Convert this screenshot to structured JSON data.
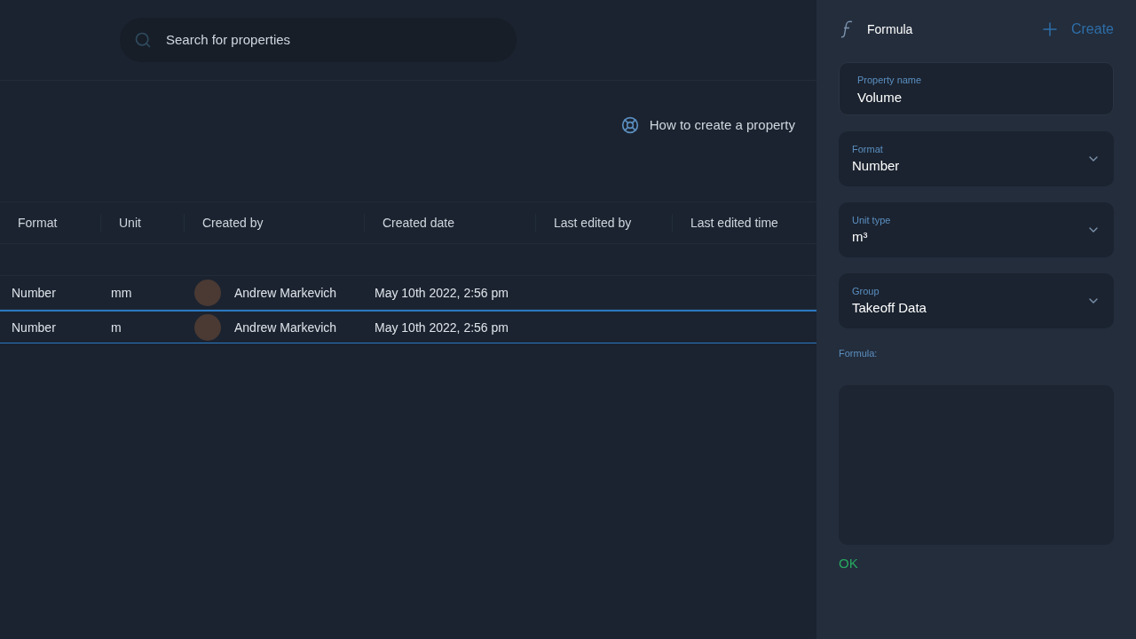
{
  "search": {
    "placeholder": "Search for properties"
  },
  "help_link": "How to create a property",
  "table": {
    "columns": [
      "Format",
      "Unit",
      "Created by",
      "Created date",
      "Last edited by",
      "Last edited time"
    ],
    "rows": [
      {
        "format": "Number",
        "unit": "mm",
        "created_by": "Andrew Markevich",
        "created_date": "May 10th 2022, 2:56 pm",
        "selected": false
      },
      {
        "format": "Number",
        "unit": "m",
        "created_by": "Andrew Markevich",
        "created_date": "May 10th 2022, 2:56 pm",
        "selected": true
      }
    ]
  },
  "panel": {
    "title": "Formula",
    "create_label": "Create",
    "fields": [
      {
        "kind": "text",
        "label": "Property name",
        "value": "Volume"
      },
      {
        "kind": "select",
        "label": "Format",
        "value": "Number"
      },
      {
        "kind": "select",
        "label": "Unit type",
        "value": "m³"
      },
      {
        "kind": "select",
        "label": "Group",
        "value": "Takeoff Data"
      }
    ],
    "formula_label": "Formula:",
    "ok_label": "OK"
  }
}
